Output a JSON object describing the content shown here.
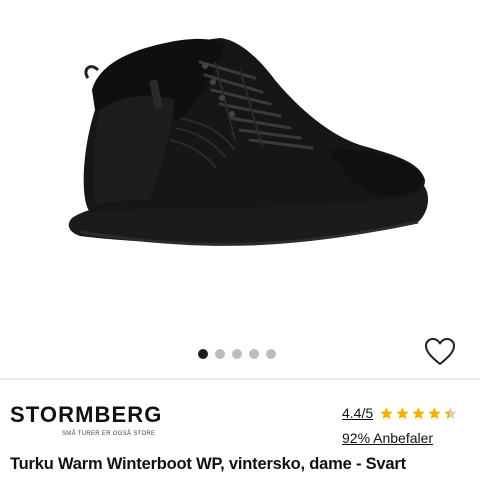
{
  "gallery": {
    "image_alt": "Black winter hiking boot",
    "dots": [
      {
        "active": true
      },
      {
        "active": false
      },
      {
        "active": false
      },
      {
        "active": false
      },
      {
        "active": false
      }
    ],
    "favorite_icon": "heart-outline-icon"
  },
  "brand": {
    "name": "STORMBERG",
    "tagline": "SMÅ TURER ER OGSÅ STORE"
  },
  "rating": {
    "score": "4.4/5",
    "stars_value": 4.4,
    "stars_max": 5,
    "star_color": "#f2b300",
    "recommend": "92% Anbefaler"
  },
  "product": {
    "title": "Turku Warm Winterboot WP, vintersko, dame - Svart"
  },
  "colors": {
    "boot": "#161616",
    "dot_active": "#1e1e1e",
    "dot_inactive": "#bdbdbd"
  }
}
